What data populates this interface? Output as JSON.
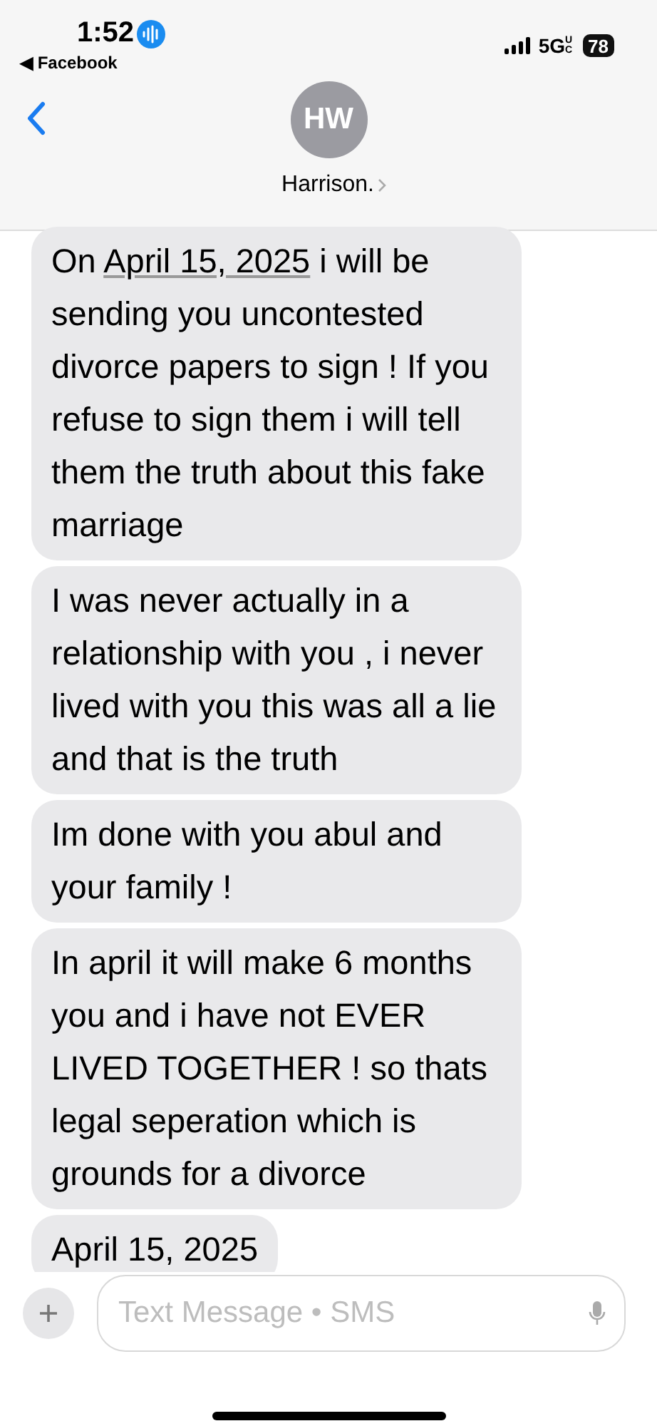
{
  "status_bar": {
    "time": "1:52",
    "back_app": "◀ Facebook",
    "network": "5G",
    "network_sub": "UC",
    "battery": "78"
  },
  "header": {
    "initials": "HW",
    "name": "Harrison."
  },
  "messages": [
    {
      "parts": [
        {
          "kind": "text",
          "text": "On "
        },
        {
          "kind": "link",
          "text": "April 15, 2025"
        },
        {
          "kind": "text",
          "text": " i will be sending you uncontested divorce papers to sign ! If you refuse to sign them i will tell them the truth about this fake marriage"
        }
      ]
    },
    {
      "parts": [
        {
          "kind": "text",
          "text": "I was never actually in a relationship with you , i never lived with you this was all a lie and that is the truth"
        }
      ]
    },
    {
      "parts": [
        {
          "kind": "text",
          "text": "Im done with you abul and your family !"
        }
      ]
    },
    {
      "parts": [
        {
          "kind": "text",
          "text": "In april it will make 6 months you and i have not EVER LIVED TOGETHER ! so thats legal seperation which is grounds for a divorce"
        }
      ]
    },
    {
      "parts": [
        {
          "kind": "text",
          "text": "April 15, 2025"
        }
      ]
    }
  ],
  "composer": {
    "placeholder": "Text Message • SMS"
  }
}
